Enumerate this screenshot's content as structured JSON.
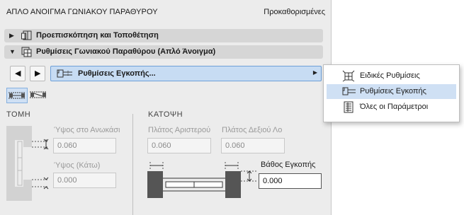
{
  "panel": {
    "title": "ΑΠΛΟ ΑΝΟΙΓΜΑ ΓΩΝΙΑΚΟΥ ΠΑΡΑΘΥΡΟΥ",
    "defaults_label": "Προκαθορισμένες"
  },
  "sections": [
    {
      "label": "Προεπισκόπηση και Τοποθέτηση",
      "expanded": false,
      "icon": "preview-icon"
    },
    {
      "label": "Ρυθμίσεις Γωνιακού Παραθύρου (Απλό Άνοιγμα)",
      "expanded": true,
      "icon": "corner-window-icon"
    }
  ],
  "toolbar": {
    "prev_glyph": "◀",
    "next_glyph": "▶",
    "page_select_label": "Ρυθμίσεις Εγκοπής...",
    "page_select_arrow": "▶"
  },
  "section_glyphs": {
    "collapsed": "▶",
    "expanded": "▼"
  },
  "tomi": {
    "header": "ΤΟΜΗ",
    "height_top_label": "Ύψος στο Ανωκάσι",
    "height_top_value": "0.060",
    "height_bottom_label": "Ύψος (Κάτω)",
    "height_bottom_value": "0.000"
  },
  "katopsi": {
    "header": "ΚΑΤΟΨΗ",
    "width_left_label": "Πλάτος Αριστερού",
    "width_left_value": "0.060",
    "width_right_label": "Πλάτος Δεξιού Λο",
    "width_right_value": "0.060",
    "depth_label": "Βάθος Εγκοπής",
    "depth_value": "0.000"
  },
  "menu": {
    "items": [
      {
        "label": "Ειδικές Ρυθμίσεις",
        "icon": "special-settings-icon",
        "selected": false
      },
      {
        "label": "Ρυθμίσεις Εγκοπής",
        "icon": "reveal-settings-icon",
        "selected": true
      },
      {
        "label": "Όλες οι Παράμετροι",
        "icon": "all-parameters-icon",
        "selected": false
      }
    ]
  },
  "colors": {
    "accent": "#c7dcf3",
    "panel_bg": "#ececec",
    "section_bg": "#d6d6d6"
  }
}
